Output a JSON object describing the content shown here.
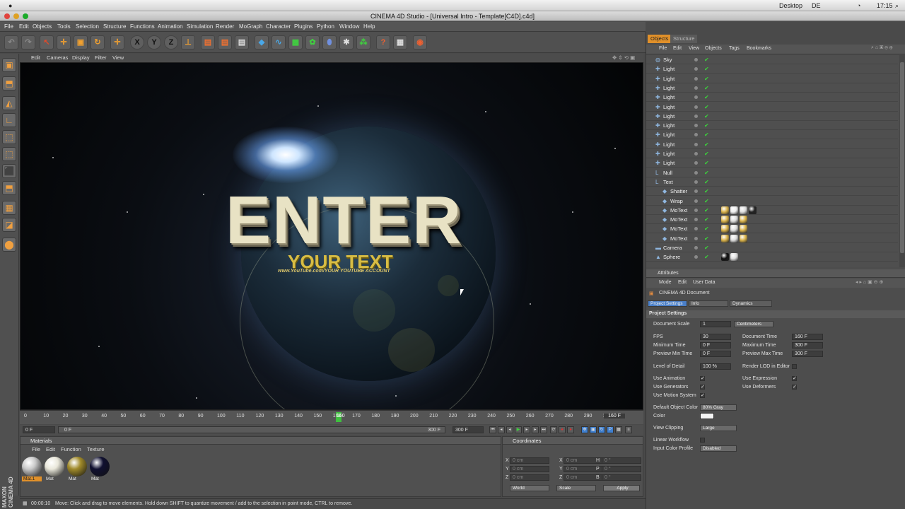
{
  "os_menubar": {
    "desktop": "Desktop",
    "lang": "DE",
    "time": "17:15"
  },
  "window": {
    "title": "CINEMA 4D Studio - [Universal Intro - Template[C4D].c4d]"
  },
  "menubar": [
    "File",
    "Edit",
    "Objects",
    "Tools",
    "Selection",
    "Structure",
    "Functions",
    "Animation",
    "Simulation",
    "Render",
    "MoGraph",
    "Character",
    "Plugins",
    "Python",
    "Window",
    "Help"
  ],
  "toolbar": {
    "axis_labels": [
      "X",
      "Y",
      "Z"
    ]
  },
  "viewport": {
    "menu": [
      "Edit",
      "Cameras",
      "Display",
      "Filter",
      "View"
    ],
    "scene_text": {
      "title": "ENTER",
      "subtitle": "YOUR TEXT",
      "line": "www.YouTube.com/YOUR YOUTUBE ACCOUNT"
    }
  },
  "timeline": {
    "ticks": [
      "0",
      "10",
      "20",
      "30",
      "40",
      "50",
      "60",
      "70",
      "80",
      "90",
      "100",
      "110",
      "120",
      "130",
      "140",
      "150",
      "160",
      "170",
      "180",
      "190",
      "200",
      "210",
      "220",
      "230",
      "240",
      "250",
      "260",
      "270",
      "280",
      "290",
      "300"
    ],
    "playhead_label": "160",
    "current_frame": "160 F",
    "start_field": "0 F",
    "min_field": "0 F",
    "end_field": "300 F",
    "max_field": "300 F"
  },
  "materials": {
    "title": "Materials",
    "menu": [
      "File",
      "Edit",
      "Function",
      "Texture"
    ],
    "items": [
      {
        "label": "Mat.1",
        "color": "#c9c9c9"
      },
      {
        "label": "Mat",
        "color": "#e9e7da"
      },
      {
        "label": "Mat",
        "color": "#a08a2a"
      },
      {
        "label": "Mat",
        "color": "#101030"
      }
    ]
  },
  "coordinates": {
    "title": "Coordinates",
    "rows": [
      {
        "a": "X",
        "av": "0 cm",
        "b": "X",
        "bv": "0 cm",
        "c": "H",
        "cv": "0 °"
      },
      {
        "a": "Y",
        "av": "0 cm",
        "b": "Y",
        "bv": "0 cm",
        "c": "P",
        "cv": "0 °"
      },
      {
        "a": "Z",
        "av": "0 cm",
        "b": "Z",
        "bv": "0 cm",
        "c": "B",
        "cv": "0 °"
      }
    ],
    "mode1": "World",
    "mode2": "Scale",
    "apply": "Apply"
  },
  "status": {
    "time": "00:00:10",
    "message": "Move: Click and drag to move elements. Hold down SHIFT to quantize movement / add to the selection in point mode, CTRL to remove."
  },
  "brand": {
    "line1": "MAXON",
    "line2": "CINEMA 4D"
  },
  "object_manager": {
    "tabs": [
      "Objects",
      "Structure"
    ],
    "menu": [
      "File",
      "Edit",
      "View",
      "Objects",
      "Tags",
      "Bookmarks"
    ],
    "objects": [
      {
        "name": "Sky",
        "indent": 0
      },
      {
        "name": "Light",
        "indent": 0
      },
      {
        "name": "Light",
        "indent": 0
      },
      {
        "name": "Light",
        "indent": 0
      },
      {
        "name": "Light",
        "indent": 0
      },
      {
        "name": "Light",
        "indent": 0
      },
      {
        "name": "Light",
        "indent": 0
      },
      {
        "name": "Light",
        "indent": 0
      },
      {
        "name": "Light",
        "indent": 0
      },
      {
        "name": "Light",
        "indent": 0
      },
      {
        "name": "Light",
        "indent": 0
      },
      {
        "name": "Light",
        "indent": 0
      },
      {
        "name": "Null",
        "indent": 0
      },
      {
        "name": "Text",
        "indent": 0
      },
      {
        "name": "Shatter",
        "indent": 1
      },
      {
        "name": "Wrap",
        "indent": 1
      },
      {
        "name": "MoText",
        "indent": 1
      },
      {
        "name": "MoText",
        "indent": 1
      },
      {
        "name": "MoText",
        "indent": 1
      },
      {
        "name": "MoText",
        "indent": 1
      },
      {
        "name": "Camera",
        "indent": 0
      },
      {
        "name": "Sphere",
        "indent": 0
      }
    ]
  },
  "attributes": {
    "title": "Attributes",
    "menu": [
      "Mode",
      "Edit",
      "User Data"
    ],
    "doc_title": "CINEMA 4D Document",
    "tabs": [
      "Project Settings",
      "Info",
      "Dynamics"
    ],
    "section": "Project Settings",
    "doc_scale_label": "Document Scale",
    "doc_scale_value": "1",
    "doc_scale_unit": "Centimeters",
    "fps_label": "FPS",
    "fps_value": "30",
    "min_time_label": "Minimum Time",
    "min_time_value": "0 F",
    "preview_min_label": "Preview Min Time",
    "preview_min_value": "0 F",
    "doc_time_label": "Document Time",
    "doc_time_value": "160 F",
    "max_time_label": "Maximum Time",
    "max_time_value": "300 F",
    "preview_max_label": "Preview Max Time",
    "preview_max_value": "300 F",
    "lod_label": "Level of Detail",
    "lod_value": "100 %",
    "render_lod_label": "Render LOD in Editor",
    "use_anim_label": "Use Animation",
    "use_gen_label": "Use Generators",
    "use_motion_label": "Use Motion System",
    "use_expr_label": "Use Expression",
    "use_deform_label": "Use Deformers",
    "def_color_label": "Default Object Color",
    "def_color_value": "80% Gray",
    "color_label": "Color",
    "clip_label": "View Clipping",
    "clip_value": "Large",
    "linear_label": "Linear Workflow",
    "icp_label": "Input Color Profile",
    "icp_value": "Disabled"
  }
}
